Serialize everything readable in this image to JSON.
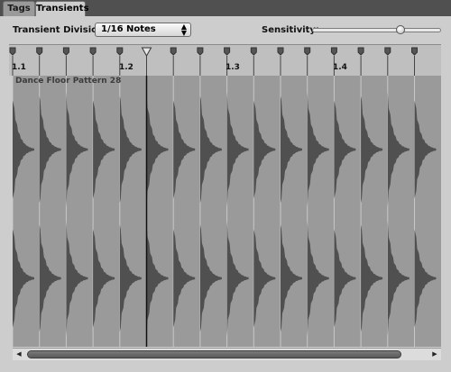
{
  "tabs": [
    {
      "label": "Tags"
    },
    {
      "label": "Transients"
    }
  ],
  "controls": {
    "division_label": "Transient Division:",
    "division_value": "1/16 Notes",
    "sensitivity_label": "Sensitivity:",
    "sensitivity_level": 0.7
  },
  "ruler": {
    "labels": [
      "1.1",
      "1.2",
      "1.3",
      "1.4"
    ]
  },
  "region": {
    "name": "Dance Floor Pattern 28"
  },
  "colors": {
    "waveform_bg": "#9a9a9a",
    "waveform_fill": "#505050",
    "playhead": "#111111"
  }
}
